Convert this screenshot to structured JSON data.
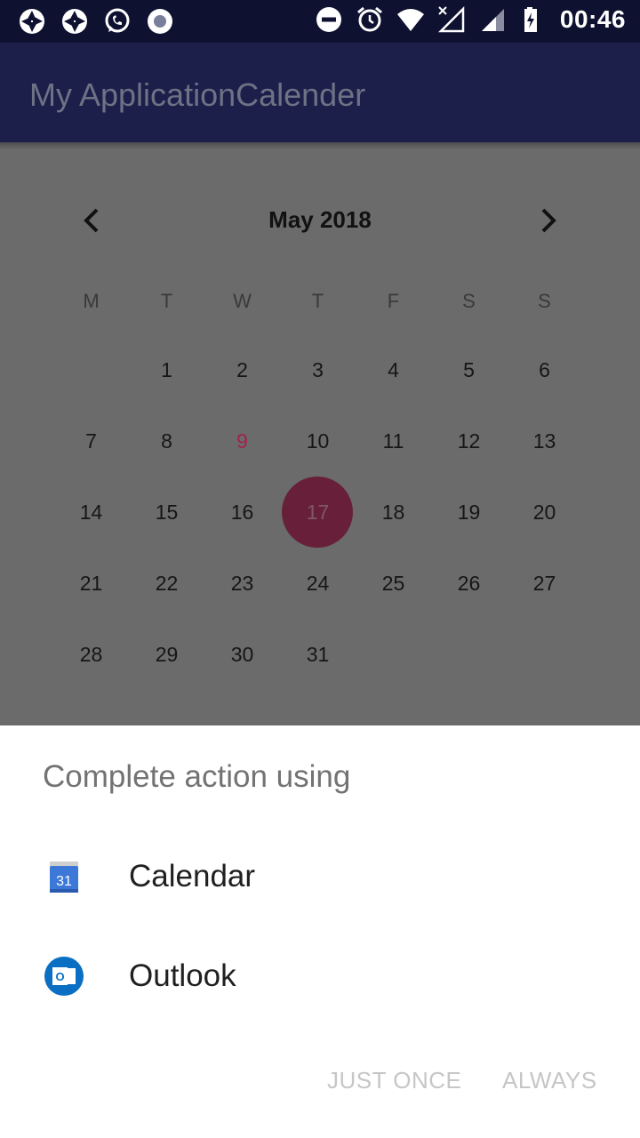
{
  "status_bar": {
    "time": "00:46",
    "left_icons": [
      "aperture-icon",
      "aperture-icon",
      "whatsapp-icon",
      "record-icon"
    ],
    "right_icons": [
      "do-not-disturb-icon",
      "alarm-icon",
      "wifi-icon",
      "no-signal-icon",
      "signal-icon",
      "battery-icon"
    ]
  },
  "app_bar": {
    "title": "My ApplicationCalender"
  },
  "calendar": {
    "month_label": "May 2018",
    "day_headers": [
      "M",
      "T",
      "W",
      "T",
      "F",
      "S",
      "S"
    ],
    "weeks": [
      [
        "",
        "1",
        "2",
        "3",
        "4",
        "5",
        "6"
      ],
      [
        "7",
        "8",
        "9",
        "10",
        "11",
        "12",
        "13"
      ],
      [
        "14",
        "15",
        "16",
        "17",
        "18",
        "19",
        "20"
      ],
      [
        "21",
        "22",
        "23",
        "24",
        "25",
        "26",
        "27"
      ],
      [
        "28",
        "29",
        "30",
        "31",
        "",
        "",
        ""
      ]
    ],
    "highlighted_day": "9",
    "selected_day": "17",
    "accent_color": "#a0234b"
  },
  "chooser": {
    "title": "Complete action using",
    "options": [
      {
        "label": "Calendar",
        "icon": "google-calendar-icon",
        "icon_text": "31"
      },
      {
        "label": "Outlook",
        "icon": "outlook-icon",
        "icon_text": "O"
      }
    ],
    "just_once_label": "JUST ONCE",
    "always_label": "ALWAYS"
  }
}
